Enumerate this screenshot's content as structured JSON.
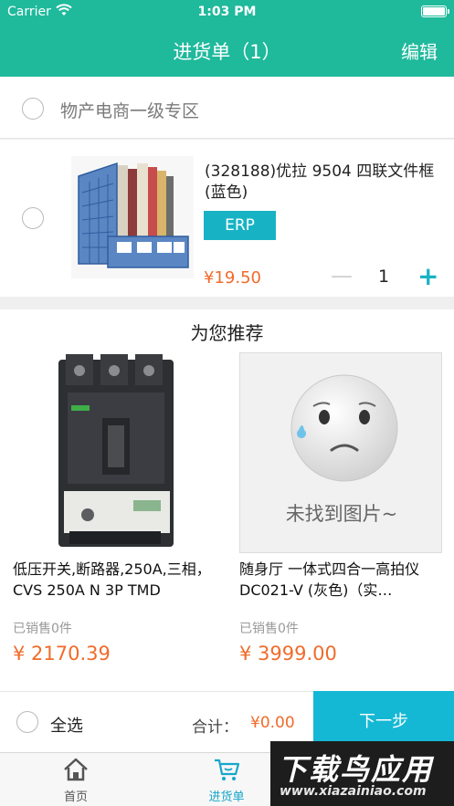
{
  "status_bar": {
    "carrier": "Carrier",
    "time": "1:03 PM"
  },
  "nav": {
    "title": "进货单（1）",
    "edit_label": "编辑"
  },
  "shop": {
    "name": "物产电商一级专区"
  },
  "cart_item": {
    "name": "(328188)优拉 9504 四联文件框(蓝色)",
    "tag": "ERP",
    "price": "¥19.50",
    "minus": "—",
    "quantity": "1",
    "plus": "+"
  },
  "recommend": {
    "title": "为您推荐",
    "items": [
      {
        "name": "低压开关,断路器,250A,三相，CVS 250A N 3P TMD",
        "sold": "已销售0件",
        "price": "¥ 2170.39"
      },
      {
        "name": "随身厅 一体式四合一高拍仪 DC021-V (灰色)（实…",
        "sold": "已销售0件",
        "price": "¥ 3999.00",
        "no_image_text": "未找到图片~"
      }
    ]
  },
  "bottom_bar": {
    "select_all": "全选",
    "total_label": "合计：",
    "total_value": "¥0.00",
    "next_label": "下一步"
  },
  "tabbar": {
    "tabs": [
      {
        "label": "首页"
      },
      {
        "label": "进货单"
      }
    ]
  },
  "watermark": {
    "big": "下载鸟应用",
    "small": "www.xiazainiao.com"
  },
  "colors": {
    "header": "#1fb99c",
    "accent": "#15b8d4",
    "price": "#f06b2a"
  }
}
